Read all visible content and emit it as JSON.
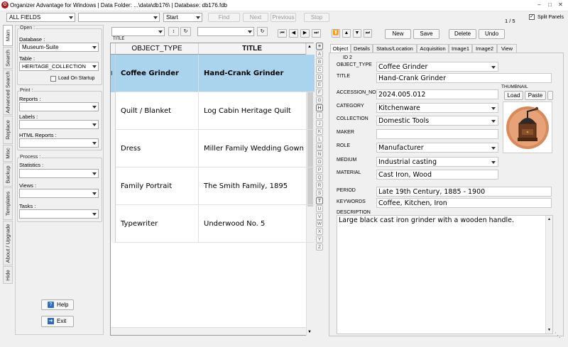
{
  "window": {
    "title": "Organizer Advantage for Windows | Data Folder: ...\\data\\db176\\ | Database: db176.fdb"
  },
  "toolbar": {
    "field_select": "ALL FIELDS",
    "search_value": "",
    "match_mode": "Start",
    "find_label": "Find",
    "next_label": "Next",
    "previous_label": "Previous",
    "stop_label": "Stop",
    "record_count": "1 / 5",
    "split_panels_label": "Split Panels"
  },
  "sidebar_tabs": [
    "Main",
    "Search",
    "Advanced Search",
    "Replace",
    "Misc",
    "Backup",
    "Templates",
    "About / Upgrade",
    "Hide"
  ],
  "left_panel": {
    "open_group": "Open :",
    "database_label": "Database :",
    "database_value": "Museum-Suite",
    "table_label": "Table :",
    "table_value": "HERITAGE_COLLECTION",
    "load_on_startup": "Load On Startup",
    "print_group": "Print :",
    "reports_label": "Reports :",
    "labels_label": "Labels :",
    "html_reports_label": "HTML Reports :",
    "process_group": "Process :",
    "statistics_label": "Statistics :",
    "views_label": "Views :",
    "tasks_label": "Tasks :",
    "help_label": "Help",
    "exit_label": "Exit"
  },
  "grid_toolbar": {
    "title_label": "TITLE"
  },
  "grid": {
    "columns": [
      "OBJECT_TYPE",
      "TITLE"
    ],
    "rows": [
      {
        "object_type": "Coffee Grinder",
        "title": "Hand-Crank Grinder",
        "selected": true
      },
      {
        "object_type": "Quilt / Blanket",
        "title": "Log Cabin Heritage Quilt",
        "selected": false
      },
      {
        "object_type": "Dress",
        "title": "Miller Family Wedding Gown",
        "selected": false
      },
      {
        "object_type": "Family Portrait",
        "title": "The Smith Family, 1895",
        "selected": false
      },
      {
        "object_type": "Typewriter",
        "title": "Underwood No. 5",
        "selected": false
      }
    ]
  },
  "alphabet": [
    "≡",
    "A",
    "B",
    "C",
    "D",
    "E",
    "F",
    "G",
    "H",
    "I",
    "J",
    "K",
    "L",
    "M",
    "N",
    "O",
    "P",
    "Q",
    "R",
    "S",
    "T",
    "U",
    "V",
    "W",
    "X",
    "Y",
    "Z"
  ],
  "record_buttons": {
    "new": "New",
    "save": "Save",
    "delete": "Delete",
    "undo": "Undo"
  },
  "detail_tabs": [
    "Object",
    "Details",
    "Status/Location",
    "Acquisition",
    "Image1",
    "Image2",
    "View"
  ],
  "record": {
    "id_label": "ID 2",
    "object_type_label": "OBJECT_TYPE",
    "object_type": "Coffee Grinder",
    "title_label": "TITLE",
    "title": "Hand-Crank Grinder",
    "accession_label": "ACCESSION_NO",
    "accession": "2024.005.012",
    "category_label": "CATEGORY",
    "category": "Kitchenware",
    "collection_label": "COLLECTION",
    "collection": "Domestic Tools",
    "maker_label": "MAKER",
    "maker": "",
    "role_label": "ROLE",
    "role": "Manufacturer",
    "medium_label": "MEDIUM",
    "medium": "Industrial casting",
    "material_label": "MATERIAL",
    "material": "Cast Iron, Wood",
    "period_label": "PERIOD",
    "period": "Late 19th Century, 1885 - 1900",
    "keywords_label": "KEYWORDS",
    "keywords": "Coffee, Kitchen, Iron",
    "description_label": "DESCRIPTION",
    "description": "Large black cast iron grinder with a wooden handle.",
    "thumbnail_label": "THUMBNAIL",
    "load_label": "Load",
    "paste_label": "Paste"
  },
  "colors": {
    "selected_row": "#aad4ee",
    "app_icon": "#a51c1c"
  }
}
